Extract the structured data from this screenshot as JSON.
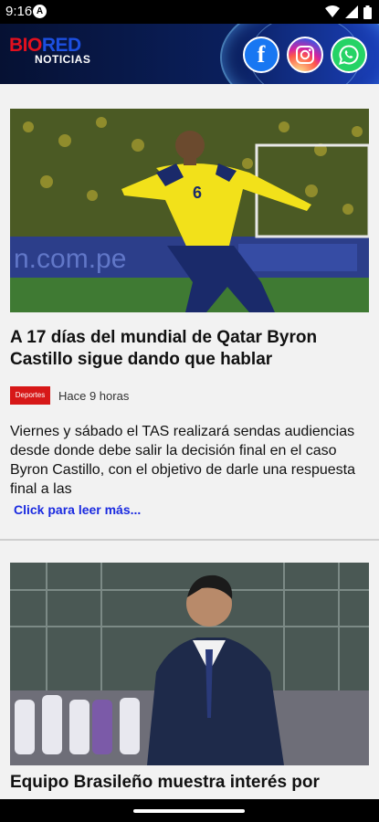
{
  "status_bar": {
    "time": "9:16",
    "notification_icon": "A"
  },
  "header": {
    "brand_part1": "BIO",
    "brand_part2": "RED",
    "brand_sub": "NOTICIAS",
    "social": [
      {
        "name": "facebook-icon",
        "glyph": "f"
      },
      {
        "name": "instagram-icon",
        "glyph": ""
      },
      {
        "name": "whatsapp-icon",
        "glyph": ""
      }
    ]
  },
  "articles": [
    {
      "title": "A 17 días del mundial de Qatar Byron Castillo sigue dando que hablar",
      "category": "Deportes",
      "time_ago": "Hace 9 horas",
      "excerpt": "Viernes y sábado el TAS realizará sendas audiencias desde donde debe salir la decisión final en el caso Byron Castillo, con el objetivo de darle una respuesta final a las",
      "read_more": "Click para leer más...",
      "jersey_number": "6",
      "board_text": "n.com.pe"
    },
    {
      "title": "Equipo Brasileño muestra interés por"
    }
  ]
}
